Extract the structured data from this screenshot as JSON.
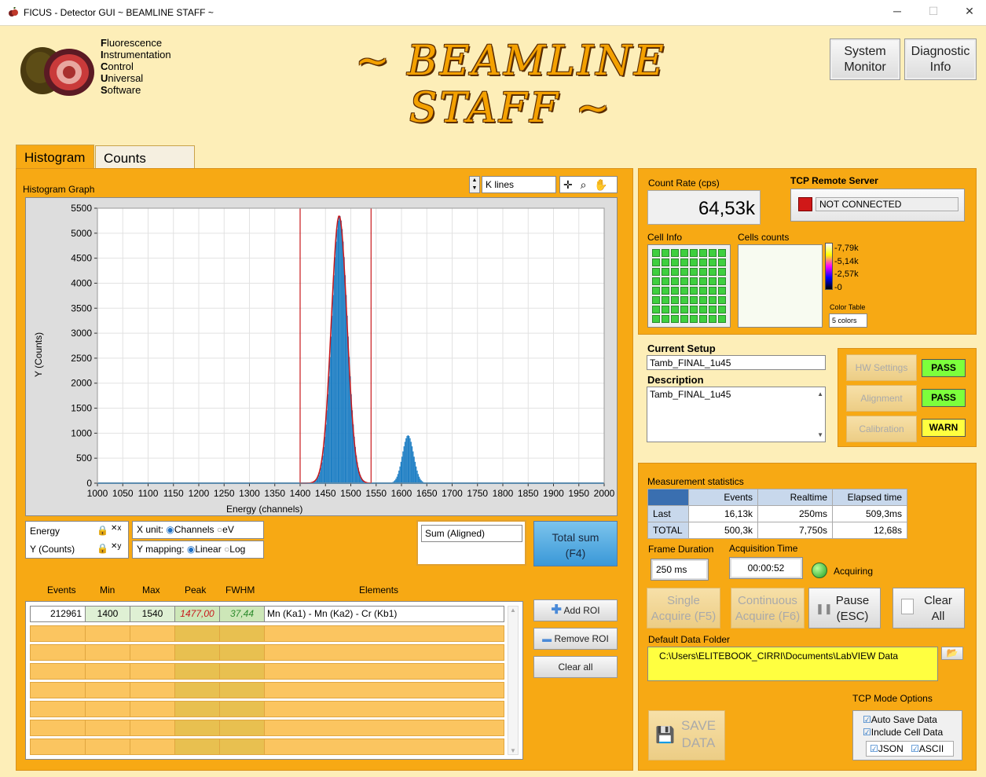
{
  "window": {
    "title": "FICUS - Detector GUI ~ BEAMLINE STAFF ~",
    "minimize": "─",
    "maximize": "☐",
    "close": "✕"
  },
  "header": {
    "acronym": [
      {
        "cap": "F",
        "rest": "luorescence"
      },
      {
        "cap": "I",
        "rest": "nstrumentation"
      },
      {
        "cap": "C",
        "rest": "ontrol"
      },
      {
        "cap": "U",
        "rest": "niversal"
      },
      {
        "cap": "S",
        "rest": "oftware"
      }
    ],
    "banner": "~ BEAMLINE STAFF ~",
    "system_monitor_line1": "System",
    "system_monitor_line2": "Monitor",
    "diagnostic_line1": "Diagnostic",
    "diagnostic_line2": "Info"
  },
  "tabs": {
    "histogram": "Histogram",
    "counts_charts": "Counts Charts"
  },
  "histogram": {
    "graph_label": "Histogram Graph",
    "lines_select": "K lines",
    "energy_legend": "Energy",
    "ycounts_legend": "Y (Counts)",
    "x_unit_label": "X unit:",
    "x_unit_channels": "Channels",
    "x_unit_ev": "eV",
    "y_map_label": "Y mapping:",
    "y_map_linear": "Linear",
    "y_map_log": "Log",
    "sum_mode": "Sum (Aligned)",
    "total_sum_line1": "Total sum",
    "total_sum_line2": "(F4)"
  },
  "chart_data": {
    "type": "bar",
    "xlabel": "Energy (channels)",
    "ylabel": "Y (Counts)",
    "xlim": [
      1000,
      2000
    ],
    "ylim": [
      0,
      5500
    ],
    "xticks": [
      1000,
      1050,
      1100,
      1150,
      1200,
      1250,
      1300,
      1350,
      1400,
      1450,
      1500,
      1550,
      1600,
      1650,
      1700,
      1750,
      1800,
      1850,
      1900,
      1950,
      2000
    ],
    "yticks": [
      0,
      500,
      1000,
      1500,
      2000,
      2500,
      3000,
      3500,
      4000,
      4500,
      5000,
      5500
    ],
    "roi_markers": [
      1400,
      1540
    ],
    "series": [
      {
        "peaks": [
          {
            "center": 1477,
            "height": 5350,
            "sigma": 15.5
          },
          {
            "center": 1612,
            "height": 960,
            "sigma": 11
          }
        ]
      }
    ],
    "color": "#1f7fc4",
    "roi_line_color": "#c8181c",
    "grid": true
  },
  "roi": {
    "headers": [
      "Events",
      "Min",
      "Max",
      "Peak",
      "FWHM",
      "Elements"
    ],
    "rows": [
      {
        "events": "212961",
        "min": "1400",
        "max": "1540",
        "peak": "1477,00",
        "fwhm": "37,44",
        "elements": "Mn (Ka1) - Mn (Ka2) - Cr (Kb1)"
      }
    ],
    "add": "Add ROI",
    "remove": "Remove ROI",
    "clear": "Clear all"
  },
  "status": {
    "count_rate_label": "Count Rate (cps)",
    "count_rate": "64,53k",
    "tcp_label": "TCP Remote Server",
    "tcp_state": "NOT CONNECTED",
    "cell_info_label": "Cell Info",
    "cells_counts_label": "Cells counts",
    "scale": [
      "7,79k",
      "5,14k",
      "2,57k",
      "0"
    ],
    "color_table_label": "Color Table",
    "color_table": "5 colors"
  },
  "setup": {
    "current_label": "Current Setup",
    "current": "Tamb_FINAL_1u45",
    "desc_label": "Description",
    "desc": "Tamb_FINAL_1u45",
    "hw": "HW Settings",
    "hw_status": "PASS",
    "align": "Alignment",
    "align_status": "PASS",
    "calib": "Calibration",
    "calib_status": "WARN"
  },
  "measure": {
    "title": "Measurement statistics",
    "cols": [
      "Events",
      "Realtime",
      "Elapsed time"
    ],
    "last": {
      "label": "Last",
      "events": "16,13k",
      "realtime": "250ms",
      "elapsed": "509,3ms"
    },
    "total": {
      "label": "TOTAL",
      "events": "500,3k",
      "realtime": "7,750s",
      "elapsed": "12,68s"
    },
    "frame_label": "Frame Duration",
    "frame": "250 ms",
    "acq_label": "Acquisition Time",
    "acq": "00:00:52",
    "acquiring": "Acquiring",
    "single1": "Single",
    "single2": "Acquire (F5)",
    "cont1": "Continuous",
    "cont2": "Acquire (F6)",
    "pause1": "Pause",
    "pause2": "(ESC)",
    "clear1": "Clear",
    "clear2": "All",
    "folder_label": "Default Data Folder",
    "folder": "C:\\Users\\ELITEBOOK_CIRRI\\Documents\\LabVIEW Data",
    "tcp_options": "TCP Mode Options",
    "save1": "SAVE",
    "save2": "DATA",
    "auto_save": "Auto Save Data",
    "include_cell": "Include Cell Data",
    "json": "JSON",
    "ascii": "ASCII"
  }
}
